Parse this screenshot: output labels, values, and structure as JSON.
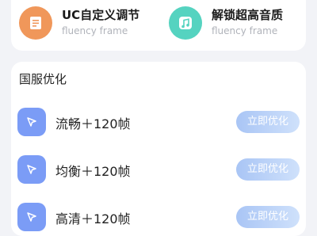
{
  "top_options": [
    {
      "title": "UC自定义调节",
      "subtitle": "fluency frame",
      "icon": "document-icon",
      "color": "#f0975a"
    },
    {
      "title": "解锁超高音质",
      "subtitle": "fluency frame",
      "icon": "music-note-icon",
      "color": "#55d3c0"
    }
  ],
  "section": {
    "title": "国服优化",
    "rows": [
      {
        "label": "流畅＋120帧",
        "button": "立即优化"
      },
      {
        "label": "均衡＋120帧",
        "button": "立即优化"
      },
      {
        "label": "高清＋120帧",
        "button": "立即优化"
      }
    ]
  },
  "colors": {
    "row_icon": "#7b9cf6",
    "button_gradient_start": "#a9c5f5",
    "button_gradient_end": "#cfe1fb",
    "background": "#f2f3f7"
  }
}
